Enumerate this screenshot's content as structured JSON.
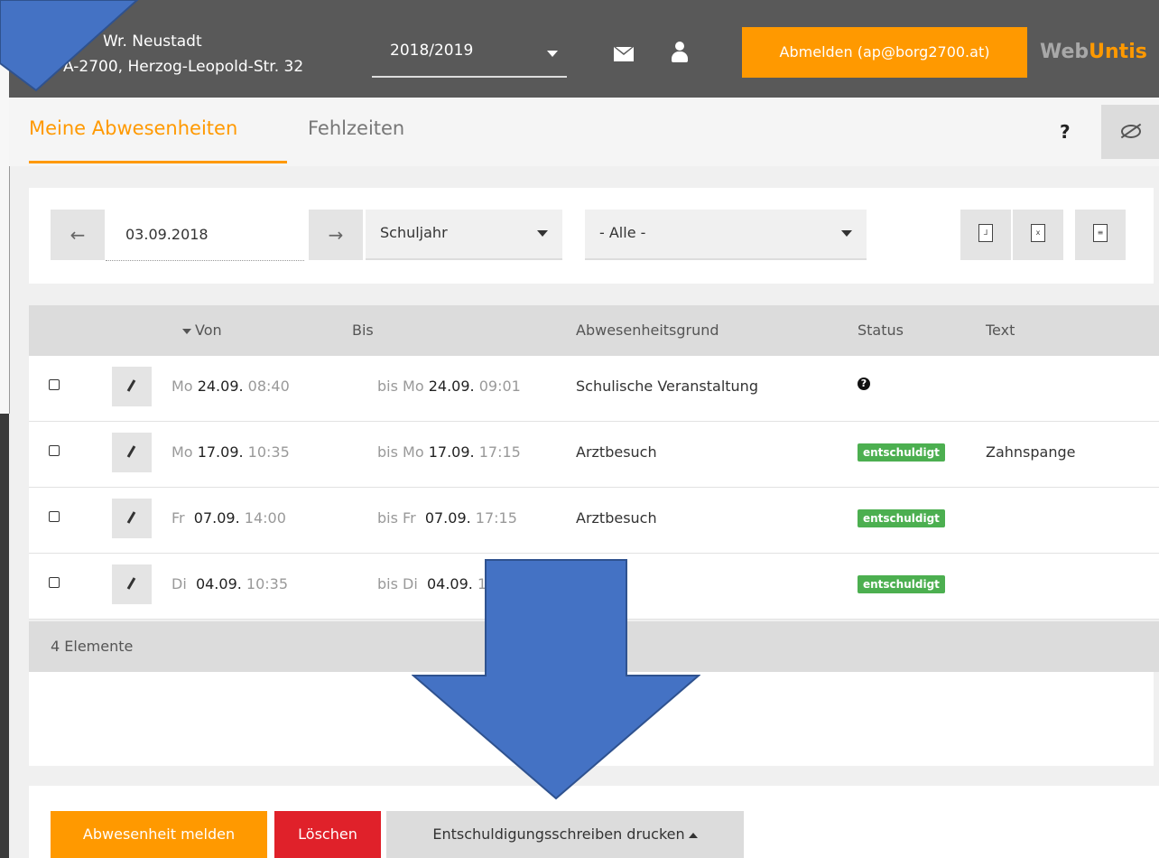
{
  "header": {
    "school_name": "Wr. Neustadt",
    "school_address": "A-2700, Herzog-Leopold-Str. 32",
    "school_year": "2018/2019",
    "logout_label": "Abmelden (ap@borg2700.at)",
    "brand_web": "Web",
    "brand_untis": "Untis"
  },
  "tabs": {
    "mine": "Meine Abwesenheiten",
    "fehlzeiten": "Fehlzeiten",
    "help": "?"
  },
  "filter": {
    "date": "03.09.2018",
    "range": "Schuljahr",
    "class": "- Alle -"
  },
  "table": {
    "headers": {
      "from": "Von",
      "to": "Bis",
      "reason": "Abwesenheitsgrund",
      "status": "Status",
      "text": "Text"
    },
    "rows": [
      {
        "from_day": "Mo",
        "from_date": "24.09.",
        "from_time": "08:40",
        "to_day": "bis Mo",
        "to_date": "24.09.",
        "to_time": "09:01",
        "reason": "Schulische Veranstaltung",
        "status": "?",
        "text": ""
      },
      {
        "from_day": "Mo",
        "from_date": "17.09.",
        "from_time": "10:35",
        "to_day": "bis Mo",
        "to_date": "17.09.",
        "to_time": "17:15",
        "reason": "Arztbesuch",
        "status": "entschuldigt",
        "text": "Zahnspange"
      },
      {
        "from_day": "Fr",
        "from_date": "07.09.",
        "from_time": "14:00",
        "to_day": "bis Fr",
        "to_date": "07.09.",
        "to_time": "17:15",
        "reason": "Arztbesuch",
        "status": "entschuldigt",
        "text": ""
      },
      {
        "from_day": "Di",
        "from_date": "04.09.",
        "from_time": "10:35",
        "to_day": "bis Di",
        "to_date": "04.09.",
        "to_time": "1",
        "reason": "",
        "status": "entschuldigt",
        "text": ""
      }
    ],
    "count": "4 Elemente"
  },
  "actions": {
    "report": "Abwesenheit melden",
    "delete": "Löschen",
    "print": "Entschuldigungsschreiben drucken"
  },
  "colors": {
    "accent": "#ff9900",
    "header_bg": "#595959",
    "excused": "#4caf50",
    "delete": "#e0212a",
    "overlay_arrow": "#4472c4"
  }
}
